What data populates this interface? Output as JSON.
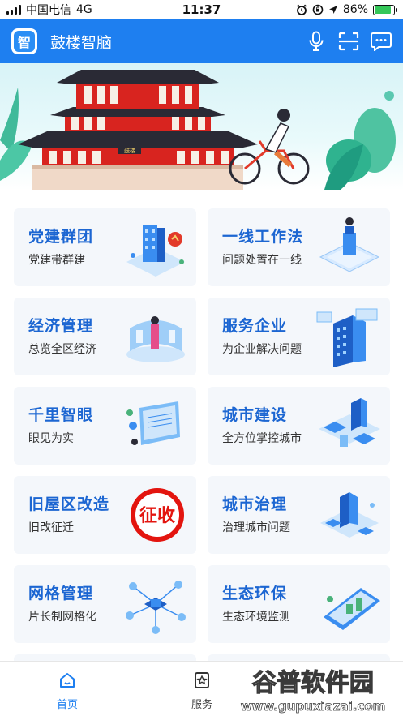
{
  "status_bar": {
    "carrier": "中国电信",
    "network": "4G",
    "time": "11:37",
    "battery_percent": "86%",
    "battery_level": 0.86,
    "icons": [
      "signal-icon",
      "alarm-icon",
      "rotation-lock-icon",
      "location-icon",
      "battery-icon"
    ]
  },
  "header": {
    "logo_char": "智",
    "title": "鼓楼智脑",
    "icons": [
      "microphone-icon",
      "scan-icon",
      "message-icon"
    ],
    "color": "#1e7ff0"
  },
  "banner": {
    "sign_text": "鼓楼",
    "colors": {
      "tower_red": "#d8241f",
      "roof": "#2a2a35",
      "sky": "#d8f3f7",
      "foliage": "#2fb38f"
    }
  },
  "grid": {
    "cards": [
      {
        "title": "党建群团",
        "subtitle": "党建带群建",
        "icon": "party-building-illustration"
      },
      {
        "title": "一线工作法",
        "subtitle": "问题处置在一线",
        "icon": "podium-illustration"
      },
      {
        "title": "经济管理",
        "subtitle": "总览全区经济",
        "icon": "economy-dashboard-illustration"
      },
      {
        "title": "服务企业",
        "subtitle": "为企业解决问题",
        "icon": "enterprise-building-illustration"
      },
      {
        "title": "千里智眼",
        "subtitle": "眼见为实",
        "icon": "monitor-screen-illustration"
      },
      {
        "title": "城市建设",
        "subtitle": "全方位掌控城市",
        "icon": "city-blocks-illustration"
      },
      {
        "title": "旧屋区改造",
        "subtitle": "旧改征迁",
        "icon": "expropriation-stamp",
        "stamp_text": "征收"
      },
      {
        "title": "城市治理",
        "subtitle": "治理城市问题",
        "icon": "city-governance-illustration"
      },
      {
        "title": "网格管理",
        "subtitle": "片长制网格化",
        "icon": "network-grid-illustration"
      },
      {
        "title": "生态环保",
        "subtitle": "生态环境监测",
        "icon": "eco-monitor-illustration"
      }
    ]
  },
  "bottom_nav": {
    "items": [
      {
        "label": "首页",
        "icon": "home-icon",
        "active": true
      },
      {
        "label": "服务",
        "icon": "star-doc-icon",
        "active": false
      }
    ]
  },
  "watermark": {
    "title": "谷普软件园",
    "url": "www.gupuxiazai.com"
  }
}
